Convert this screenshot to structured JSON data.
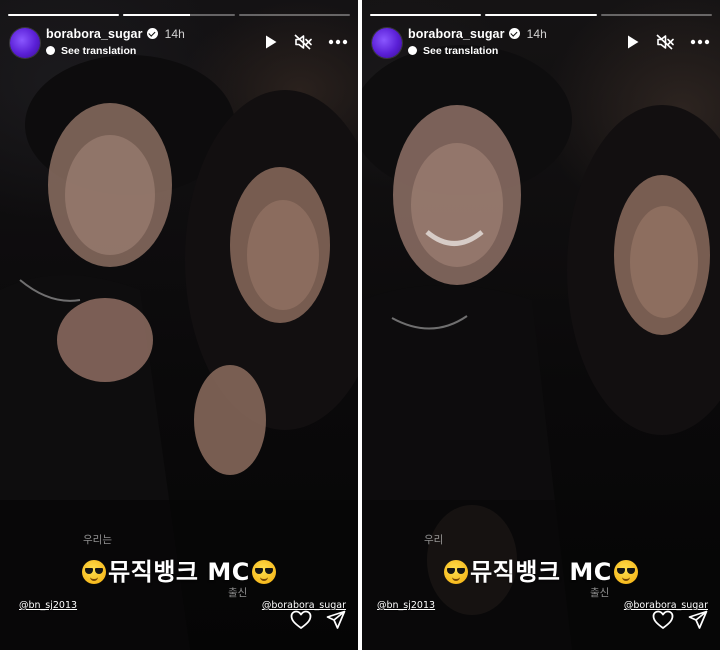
{
  "stories": [
    {
      "username": "borabora_sugar",
      "time": "14h",
      "translation_label": "See translation",
      "progress": [
        1.0,
        0.6,
        0.0
      ],
      "caption_above": "우리는",
      "caption_main": "뮤직뱅크 MC",
      "caption_below": "출신",
      "mention_left": "@bn_sj2013",
      "mention_right": "@borabora_sugar"
    },
    {
      "username": "borabora_sugar",
      "time": "14h",
      "translation_label": "See translation",
      "progress": [
        1.0,
        1.0,
        0.0
      ],
      "caption_above": "우리",
      "caption_main": "뮤직뱅크 MC",
      "caption_below": "출신",
      "mention_left": "@bn_sj2013",
      "mention_right": "@borabora_sugar"
    }
  ],
  "icons": [
    "avatar",
    "verified-badge-icon",
    "translate-icon",
    "play-icon",
    "mute-icon",
    "more-icon",
    "sunglasses-emoji-icon",
    "heart-icon",
    "send-icon"
  ]
}
